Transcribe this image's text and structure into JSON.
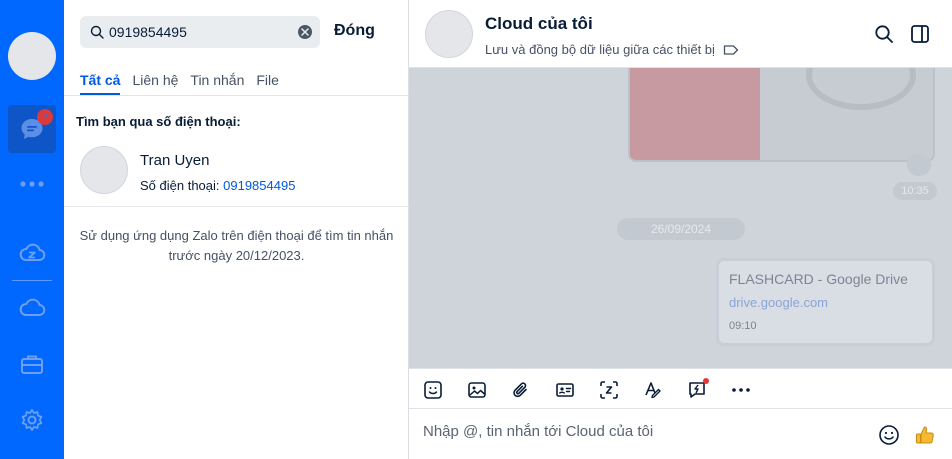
{
  "rail": {
    "badge_count": "2",
    "items": [
      "avatar",
      "messages-icon",
      "more-icon",
      "zcloud-icon",
      "cloud-icon",
      "briefcase-icon",
      "settings-icon"
    ]
  },
  "search": {
    "value": "0919854495",
    "close_label": "Đóng",
    "tabs": [
      "Tất cả",
      "Liên hệ",
      "Tin nhắn",
      "File"
    ],
    "active_tab": "Tất cả",
    "section_title": "Tìm bạn qua số điện thoại:",
    "result": {
      "name": "Tran Uyen",
      "phone_label": "Số điện thoại:",
      "phone": "0919854495"
    },
    "hint": "Sử dụng ứng dụng Zalo trên điện thoại để tìm tin nhắn trước ngày 20/12/2023."
  },
  "chat": {
    "title": "Cloud của tôi",
    "subtitle": "Lưu và đồng bộ dữ liệu giữa các thiết bị",
    "messages": {
      "image_time": "10:35",
      "date_separator": "26/09/2024",
      "link_card": {
        "title": "FLASHCARD - Google Drive",
        "url": "drive.google.com",
        "time": "09:10"
      }
    },
    "composer_placeholder": "Nhập @, tin nhắn tới Cloud của tôi"
  },
  "colors": {
    "rail_blue": "#0068ff",
    "link_blue": "#005ae0",
    "overlay_gray": "#cfd4db"
  }
}
